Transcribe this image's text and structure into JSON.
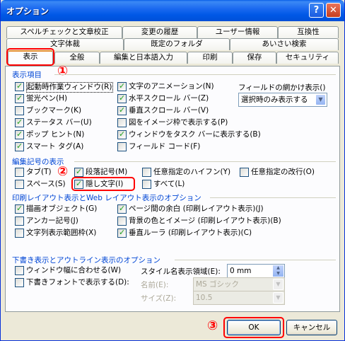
{
  "window": {
    "title": "オプション",
    "help_glyph": "?",
    "close_glyph": "✕"
  },
  "tabs_row1": [
    "スペルチェックと文章校正",
    "変更の履歴",
    "ユーザー情報",
    "互換性"
  ],
  "tabs_row2": [
    "文字体裁",
    "既定のフォルダ",
    "あいさい検索"
  ],
  "tabs_row3": [
    "表示",
    "全般",
    "編集と日本語入力",
    "印刷",
    "保存",
    "セキュリティ"
  ],
  "sections": {
    "display": "表示項目",
    "marks": "編集記号の表示",
    "print_layout": "印刷レイアウト表示とWeb レイアウト表示のオプション",
    "draft": "下書き表示とアウトライン表示のオプション"
  },
  "display_col1": [
    {
      "label": "起動時作業ウィンドウ(R)",
      "checked": true
    },
    {
      "label": "蛍光ペン(H)",
      "checked": true
    },
    {
      "label": "ブックマーク(K)",
      "checked": false
    },
    {
      "label": "ステータス バー(U)",
      "checked": true
    },
    {
      "label": "ポップ ヒント(N)",
      "checked": true
    },
    {
      "label": "スマート タグ(A)",
      "checked": true
    }
  ],
  "display_col2": [
    {
      "label": "文字のアニメーション(N)",
      "checked": true
    },
    {
      "label": "水平スクロール バー(Z)",
      "checked": true
    },
    {
      "label": "垂直スクロール バー(V)",
      "checked": true
    },
    {
      "label": "図をイメージ枠で表示する(P)",
      "checked": false
    },
    {
      "label": "ウィンドウをタスク バーに表示する(B)",
      "checked": true
    },
    {
      "label": "フィールド コード(F)",
      "checked": false
    }
  ],
  "field_shading": {
    "label": "フィールドの網かけ表示()",
    "value": "選択時のみ表示する"
  },
  "marks_row1": [
    {
      "label": "タブ(T)",
      "checked": false
    },
    {
      "label": "段落記号(M)",
      "checked": true
    },
    {
      "label": "任意指定のハイフン(Y)",
      "checked": false
    },
    {
      "label": "任意指定の改行(O)",
      "checked": false
    }
  ],
  "marks_row2": [
    {
      "label": "スペース(S)",
      "checked": false
    },
    {
      "label": "隠し文字(I)",
      "checked": true
    },
    {
      "label": "すべて(L)",
      "checked": false
    }
  ],
  "print_col1": [
    {
      "label": "描画オブジェクト(G)",
      "checked": true
    },
    {
      "label": "アンカー記号(J)",
      "checked": false
    },
    {
      "label": "文字列表示範囲枠(X)",
      "checked": false
    }
  ],
  "print_col2": [
    {
      "label": "ページ間の余白 (印刷レイアウト表示)(J)",
      "checked": true
    },
    {
      "label": "背景の色とイメージ (印刷レイアウト表示)(B)",
      "checked": false
    },
    {
      "label": "垂直ルーラ (印刷レイアウト表示)(C)",
      "checked": true
    }
  ],
  "draft_left": [
    {
      "label": "ウィンドウ幅に合わせる(W)",
      "checked": false
    },
    {
      "label": "下書きフォントで表示する(D):",
      "checked": false
    }
  ],
  "style_area": {
    "label": "スタイル名表示領域(E):",
    "value": "0 mm"
  },
  "font_name": {
    "label": "名前(E):",
    "value": "MS ゴシック"
  },
  "font_size": {
    "label": "サイズ(Z):",
    "value": "10.5"
  },
  "buttons": {
    "ok": "OK",
    "cancel": "キャンセル"
  },
  "annotations": {
    "n1": "①",
    "n2": "②",
    "n3": "③"
  }
}
